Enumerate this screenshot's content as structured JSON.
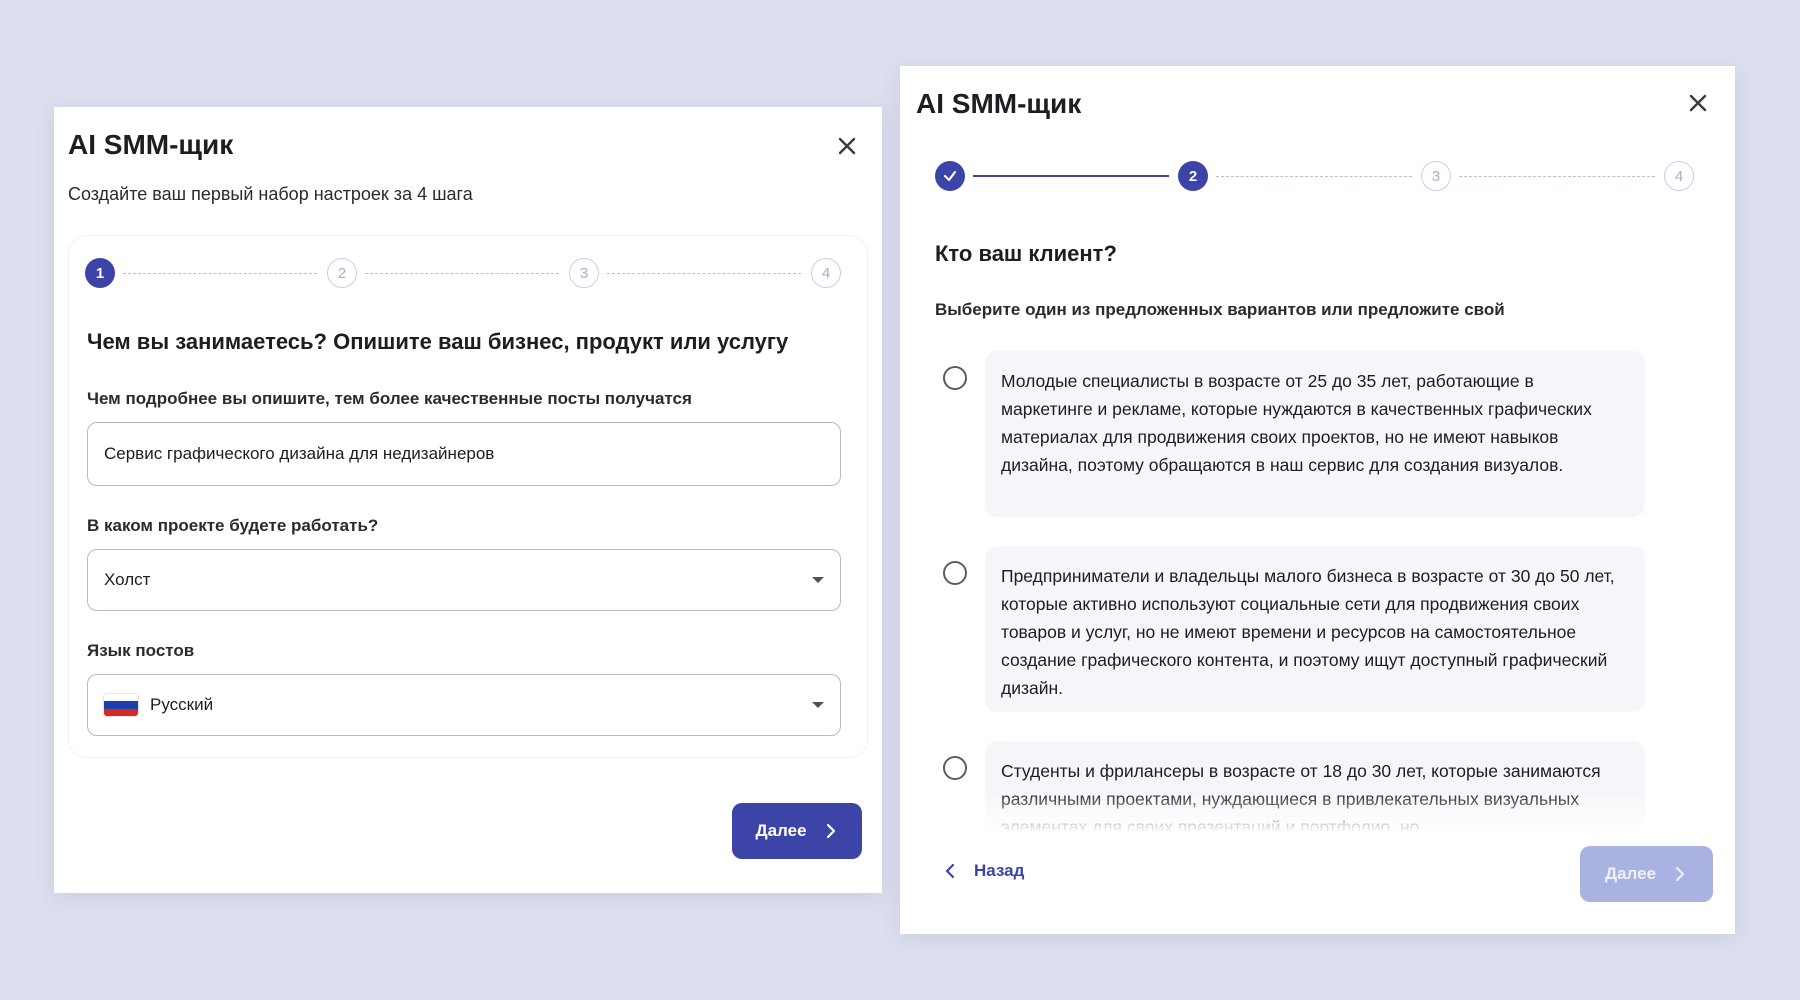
{
  "left_dialog": {
    "title": "AI SMM-щик",
    "subtitle": "Создайте ваш первый набор настроек за 4 шага",
    "steps": [
      "1",
      "2",
      "3",
      "4"
    ],
    "current_step": 1,
    "question": "Чем вы занимаетесь? Опишите ваш бизнес, продукт или услугу",
    "description_label": "Чем подробнее вы опишите, тем более качественные посты получатся",
    "description_value": "Сервис графического дизайна для недизайнеров",
    "project_label": "В каком проекте будете работать?",
    "project_value": "Холст",
    "language_label": "Язык постов",
    "language_value": "Русский",
    "next_label": "Далее"
  },
  "right_dialog": {
    "title": "AI SMM-щик",
    "steps": [
      "1",
      "2",
      "3",
      "4"
    ],
    "current_step": 2,
    "question": "Кто ваш клиент?",
    "instruction": "Выберите один из предложенных вариантов или предложите свой",
    "options": [
      "Молодые специалисты в возрасте от 25 до 35 лет, работающие в маркетинге и рекламе, которые нуждаются в качественных графических материалах для продвижения своих проектов, но не имеют навыков дизайна, поэтому обращаются в наш сервис для создания визуалов.",
      "Предприниматели и владельцы малого бизнеса в возрасте от 30 до 50 лет, которые активно используют социальные сети для продвижения своих товаров и услуг, но не имеют времени и ресурсов на самостоятельное создание графического контента, и поэтому ищут доступный графический дизайн.",
      "Студенты и фрилансеры в возрасте от 18 до 30 лет, которые занимаются различными проектами, нуждающиеся в привлекательных визуальных элементах для своих презентаций и портфолио, но"
    ],
    "back_label": "Назад",
    "next_label": "Далее"
  },
  "colors": {
    "accent": "#3d44a8",
    "disabled_button": "#a9b2e0",
    "background": "#dcdfee",
    "option_bg": "#f5f6f9"
  },
  "icons": {
    "close": "close-icon",
    "chevron_right": "chevron-right-icon",
    "chevron_left": "chevron-left-icon",
    "check": "check-icon",
    "caret": "caret-down-icon",
    "flag": "russia-flag-icon"
  }
}
